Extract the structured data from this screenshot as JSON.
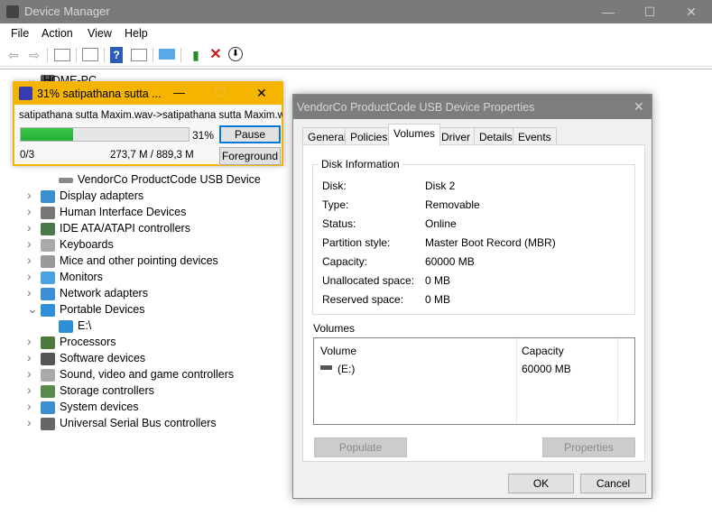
{
  "window": {
    "title": "Device Manager",
    "minimize": "—",
    "maximize": "☐",
    "close": "✕"
  },
  "menu": [
    "File",
    "Action",
    "View",
    "Help"
  ],
  "toolbar": [
    "back-icon",
    "forward-icon",
    "show-hide-console-tree-icon",
    "properties-icon",
    "help-icon",
    "action-pane-icon",
    "scan-hardware-icon",
    "update-driver-icon",
    "uninstall-icon",
    "disable-device-icon"
  ],
  "tree": {
    "root": "HOME-PC",
    "items": [
      {
        "label": "VendorCo ProductCode USB Device",
        "child": true,
        "icon": "#888"
      },
      {
        "label": "Display adapters",
        "icon": "#3a8fd0"
      },
      {
        "label": "Human Interface Devices",
        "icon": "#777"
      },
      {
        "label": "IDE ATA/ATAPI controllers",
        "icon": "#4a7a4a"
      },
      {
        "label": "Keyboards",
        "icon": "#aaa"
      },
      {
        "label": "Mice and other pointing devices",
        "icon": "#999"
      },
      {
        "label": "Monitors",
        "icon": "#4aa3e0"
      },
      {
        "label": "Network adapters",
        "icon": "#3b8fd6"
      },
      {
        "label": "Portable Devices",
        "icon": "#2d8fd8",
        "expanded": true
      },
      {
        "label": "E:\\",
        "child": true,
        "icon": "#2d8fd8"
      },
      {
        "label": "Processors",
        "icon": "#4d7a3a"
      },
      {
        "label": "Software devices",
        "icon": "#555"
      },
      {
        "label": "Sound, video and game controllers",
        "icon": "#aaa"
      },
      {
        "label": "Storage controllers",
        "icon": "#5a8a4a"
      },
      {
        "label": "System devices",
        "icon": "#3a8fd0"
      },
      {
        "label": "Universal Serial Bus controllers",
        "icon": "#666"
      }
    ]
  },
  "progress": {
    "title": "31% satipathana sutta ...",
    "file": "satipathana sutta Maxim.wav->satipathana sutta Maxim.wa",
    "percent_label": "31%",
    "percent": 31,
    "count": "0/3",
    "size": "273,7 M / 889,3 M",
    "pause": "Pause",
    "foreground": "Foreground",
    "minimize": "—",
    "maximize": "☐",
    "close": "✕",
    "accent": "#f5b400"
  },
  "props": {
    "title": "VendorCo ProductCode USB Device Properties",
    "close": "✕",
    "tabs": [
      "General",
      "Policies",
      "Volumes",
      "Driver",
      "Details",
      "Events"
    ],
    "active_tab": "Volumes",
    "disk_info_title": "Disk Information",
    "disk_info": [
      [
        "Disk:",
        "Disk 2"
      ],
      [
        "Type:",
        "Removable"
      ],
      [
        "Status:",
        "Online"
      ],
      [
        "Partition style:",
        "Master Boot Record (MBR)"
      ],
      [
        "Capacity:",
        "60000 MB"
      ],
      [
        "Unallocated space:",
        "0 MB"
      ],
      [
        "Reserved space:",
        "0 MB"
      ]
    ],
    "volumes_title": "Volumes",
    "columns": [
      "Volume",
      "Capacity"
    ],
    "rows": [
      [
        "(E:)",
        "60000 MB"
      ]
    ],
    "populate": "Populate",
    "properties": "Properties",
    "ok": "OK",
    "cancel": "Cancel"
  }
}
